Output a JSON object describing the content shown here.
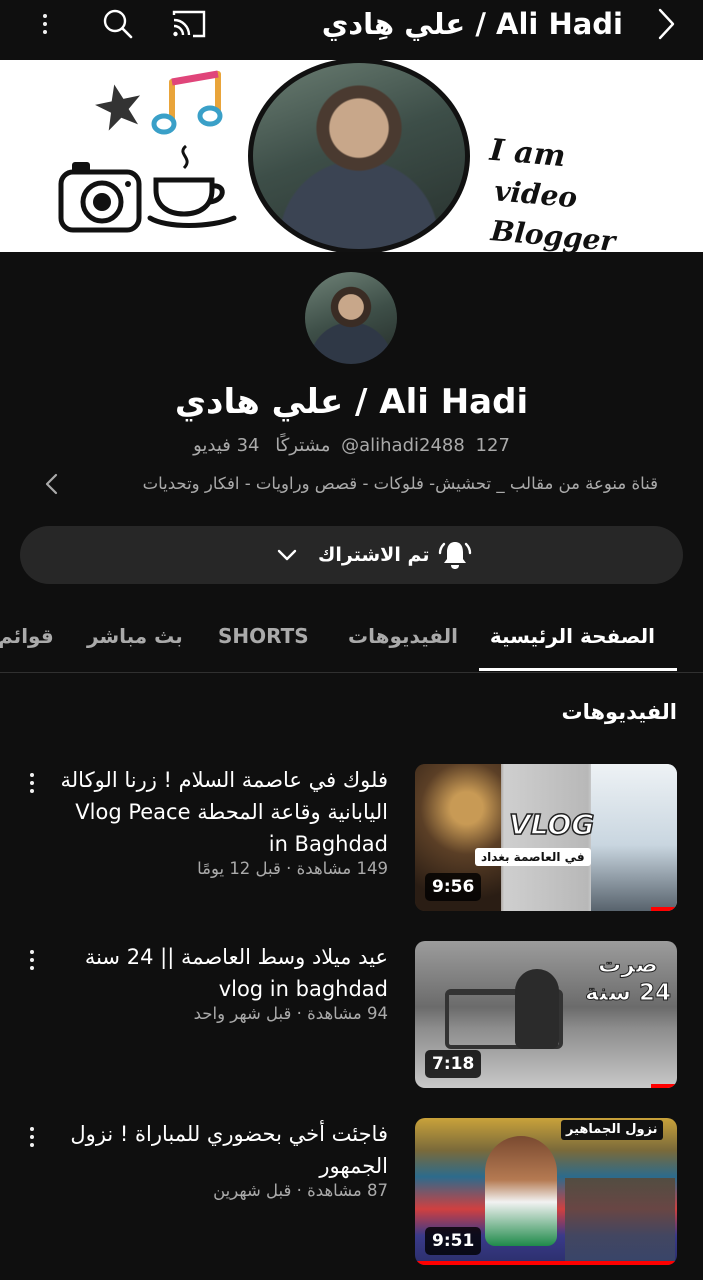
{
  "app": {
    "title": "علي هِادي / Ali Hadi"
  },
  "banner": {
    "line1": "I am",
    "line2": "video Blogger"
  },
  "channel": {
    "name": "علي هادي / Ali Hadi",
    "handle": "@alihadi2488",
    "subscribers": "127 مشتركًا",
    "videos_count": "34 فيديو",
    "description": "قناة منوعة من مقالب _ تحشيش- فلوكات - قصص وراويات - افكار وتحديات"
  },
  "subscribe": {
    "label": "تم الاشتراك"
  },
  "tabs": [
    {
      "label": "الصفحة الرئيسية",
      "active": true
    },
    {
      "label": "الفيديوهات",
      "active": false
    },
    {
      "label": "SHORTS",
      "active": false
    },
    {
      "label": "بث مباشر",
      "active": false
    },
    {
      "label": "قوائم",
      "active": false
    }
  ],
  "section": {
    "title": "الفيديوهات"
  },
  "videos": [
    {
      "title": "فلوك في عاصمة السلام ! زرنا الوكالة اليابانية وقاعة المحطة Vlog Peace in Baghdad",
      "meta": "149 مشاهدة · قبل 12 يومًا",
      "duration": "9:56",
      "thumb_caption": "VLOG",
      "thumb_sub": "في العاصمة بغداد",
      "progress": 0.1
    },
    {
      "title": "عيد ميلاد وسط العاصمة || 24 سنة vlog in baghdad",
      "meta": "94 مشاهدة · قبل شهر واحد",
      "duration": "7:18",
      "thumb_caption": "صرت 24 سنة",
      "progress": 0.1
    },
    {
      "title": "فاجئت أخي بحضوري للمباراة ! نزول الجمهور",
      "meta": "87 مشاهدة · قبل شهرين",
      "duration": "9:51",
      "thumb_caption": "نزول الجماهير",
      "progress": 1.0
    }
  ],
  "colors": {
    "background": "#0f0f0f",
    "pill": "#272727",
    "progress": "#ff0000",
    "secondary_text": "#aaaaaa"
  }
}
